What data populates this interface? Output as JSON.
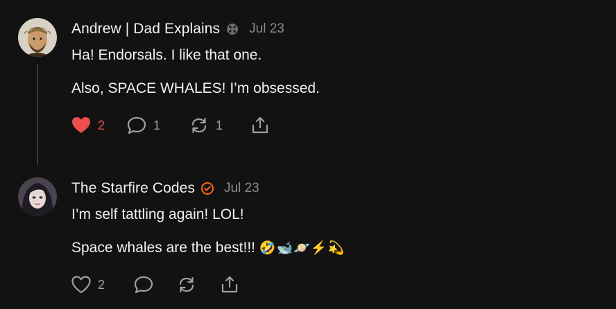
{
  "comments": [
    {
      "author": "Andrew | Dad Explains",
      "date": "Jul 23",
      "lines": [
        "Ha! Endorsals. I like that one.",
        "Also, SPACE WHALES! I’m obsessed."
      ],
      "likes": "2",
      "replies": "1",
      "restacks": "1",
      "liked": true,
      "badge_icon": "gray-badge-icon"
    },
    {
      "author": "The Starfire Codes",
      "date": "Jul 23",
      "lines": [
        "I’m self tattling again! LOL!",
        "Space whales are the best!!!"
      ],
      "emoji": "🤣🐋🪐⚡💫",
      "likes": "2",
      "liked": false,
      "badge_icon": "orange-check-badge-icon"
    }
  ],
  "colors": {
    "background": "#121212",
    "heart_liked": "#ef4e4e",
    "verified_orange": "#ff6719",
    "muted": "#8a8a8a"
  }
}
